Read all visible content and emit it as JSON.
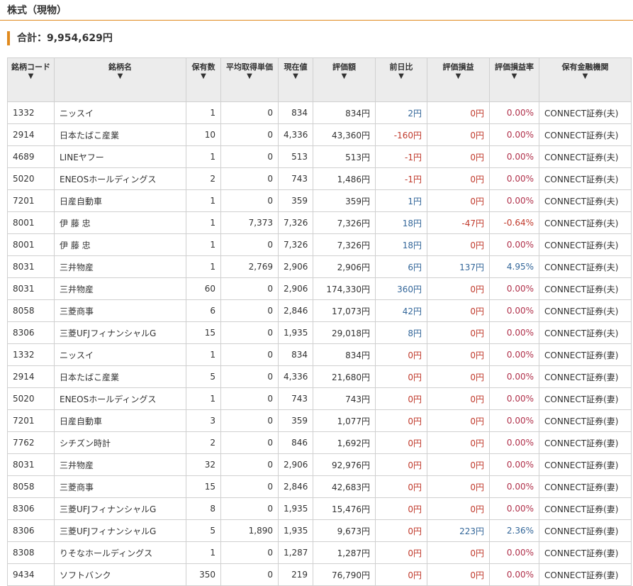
{
  "section_title": "株式（現物）",
  "total_label": "合計：9,954,629円",
  "colors": {
    "accent": "#e08a1e",
    "up": "#336699",
    "down": "#c0392b"
  },
  "headers": [
    {
      "label": "銘柄コード",
      "sort": "▼"
    },
    {
      "label": "銘柄名",
      "sort": "▼"
    },
    {
      "label": "保有数",
      "sort": "▼"
    },
    {
      "label": "平均取得単価",
      "sort": "▼"
    },
    {
      "label": "現在値",
      "sort": "▼"
    },
    {
      "label": "評価額",
      "sort": "▼"
    },
    {
      "label": "前日比",
      "sort": "▼"
    },
    {
      "label": "評価損益",
      "sort": "▼"
    },
    {
      "label": "評価損益率",
      "sort": "▼"
    },
    {
      "label": "保有金融機関",
      "sort": "▼"
    }
  ],
  "rows": [
    {
      "code": "1332",
      "name": "ニッスイ",
      "qty": "1",
      "avg": "0",
      "price": "834",
      "value": "834円",
      "change": "2円",
      "change_dir": "up",
      "pl": "0円",
      "pl_dir": "zero",
      "rate": "0.00%",
      "rate_dir": "zero",
      "inst": "CONNECT証券(夫)"
    },
    {
      "code": "2914",
      "name": "日本たばこ産業",
      "qty": "10",
      "avg": "0",
      "price": "4,336",
      "value": "43,360円",
      "change": "-160円",
      "change_dir": "down",
      "pl": "0円",
      "pl_dir": "zero",
      "rate": "0.00%",
      "rate_dir": "zero",
      "inst": "CONNECT証券(夫)"
    },
    {
      "code": "4689",
      "name": "LINEヤフー",
      "qty": "1",
      "avg": "0",
      "price": "513",
      "value": "513円",
      "change": "-1円",
      "change_dir": "down",
      "pl": "0円",
      "pl_dir": "zero",
      "rate": "0.00%",
      "rate_dir": "zero",
      "inst": "CONNECT証券(夫)"
    },
    {
      "code": "5020",
      "name": "ENEOSホールディングス",
      "qty": "2",
      "avg": "0",
      "price": "743",
      "value": "1,486円",
      "change": "-1円",
      "change_dir": "down",
      "pl": "0円",
      "pl_dir": "zero",
      "rate": "0.00%",
      "rate_dir": "zero",
      "inst": "CONNECT証券(夫)"
    },
    {
      "code": "7201",
      "name": "日産自動車",
      "qty": "1",
      "avg": "0",
      "price": "359",
      "value": "359円",
      "change": "1円",
      "change_dir": "up",
      "pl": "0円",
      "pl_dir": "zero",
      "rate": "0.00%",
      "rate_dir": "zero",
      "inst": "CONNECT証券(夫)"
    },
    {
      "code": "8001",
      "name": "伊 藤 忠",
      "qty": "1",
      "avg": "7,373",
      "price": "7,326",
      "value": "7,326円",
      "change": "18円",
      "change_dir": "up",
      "pl": "-47円",
      "pl_dir": "down",
      "rate": "-0.64%",
      "rate_dir": "down",
      "inst": "CONNECT証券(夫)"
    },
    {
      "code": "8001",
      "name": "伊 藤 忠",
      "qty": "1",
      "avg": "0",
      "price": "7,326",
      "value": "7,326円",
      "change": "18円",
      "change_dir": "up",
      "pl": "0円",
      "pl_dir": "zero",
      "rate": "0.00%",
      "rate_dir": "zero",
      "inst": "CONNECT証券(夫)"
    },
    {
      "code": "8031",
      "name": "三井物産",
      "qty": "1",
      "avg": "2,769",
      "price": "2,906",
      "value": "2,906円",
      "change": "6円",
      "change_dir": "up",
      "pl": "137円",
      "pl_dir": "up",
      "rate": "4.95%",
      "rate_dir": "up",
      "inst": "CONNECT証券(夫)"
    },
    {
      "code": "8031",
      "name": "三井物産",
      "qty": "60",
      "avg": "0",
      "price": "2,906",
      "value": "174,330円",
      "change": "360円",
      "change_dir": "up",
      "pl": "0円",
      "pl_dir": "zero",
      "rate": "0.00%",
      "rate_dir": "zero",
      "inst": "CONNECT証券(夫)"
    },
    {
      "code": "8058",
      "name": "三菱商事",
      "qty": "6",
      "avg": "0",
      "price": "2,846",
      "value": "17,073円",
      "change": "42円",
      "change_dir": "up",
      "pl": "0円",
      "pl_dir": "zero",
      "rate": "0.00%",
      "rate_dir": "zero",
      "inst": "CONNECT証券(夫)"
    },
    {
      "code": "8306",
      "name": "三菱UFJフィナンシャルG",
      "qty": "15",
      "avg": "0",
      "price": "1,935",
      "value": "29,018円",
      "change": "8円",
      "change_dir": "up",
      "pl": "0円",
      "pl_dir": "zero",
      "rate": "0.00%",
      "rate_dir": "zero",
      "inst": "CONNECT証券(夫)"
    },
    {
      "code": "1332",
      "name": "ニッスイ",
      "qty": "1",
      "avg": "0",
      "price": "834",
      "value": "834円",
      "change": "0円",
      "change_dir": "zero",
      "pl": "0円",
      "pl_dir": "zero",
      "rate": "0.00%",
      "rate_dir": "zero",
      "inst": "CONNECT証券(妻)"
    },
    {
      "code": "2914",
      "name": "日本たばこ産業",
      "qty": "5",
      "avg": "0",
      "price": "4,336",
      "value": "21,680円",
      "change": "0円",
      "change_dir": "zero",
      "pl": "0円",
      "pl_dir": "zero",
      "rate": "0.00%",
      "rate_dir": "zero",
      "inst": "CONNECT証券(妻)"
    },
    {
      "code": "5020",
      "name": "ENEOSホールディングス",
      "qty": "1",
      "avg": "0",
      "price": "743",
      "value": "743円",
      "change": "0円",
      "change_dir": "zero",
      "pl": "0円",
      "pl_dir": "zero",
      "rate": "0.00%",
      "rate_dir": "zero",
      "inst": "CONNECT証券(妻)"
    },
    {
      "code": "7201",
      "name": "日産自動車",
      "qty": "3",
      "avg": "0",
      "price": "359",
      "value": "1,077円",
      "change": "0円",
      "change_dir": "zero",
      "pl": "0円",
      "pl_dir": "zero",
      "rate": "0.00%",
      "rate_dir": "zero",
      "inst": "CONNECT証券(妻)"
    },
    {
      "code": "7762",
      "name": "シチズン時計",
      "qty": "2",
      "avg": "0",
      "price": "846",
      "value": "1,692円",
      "change": "0円",
      "change_dir": "zero",
      "pl": "0円",
      "pl_dir": "zero",
      "rate": "0.00%",
      "rate_dir": "zero",
      "inst": "CONNECT証券(妻)"
    },
    {
      "code": "8031",
      "name": "三井物産",
      "qty": "32",
      "avg": "0",
      "price": "2,906",
      "value": "92,976円",
      "change": "0円",
      "change_dir": "zero",
      "pl": "0円",
      "pl_dir": "zero",
      "rate": "0.00%",
      "rate_dir": "zero",
      "inst": "CONNECT証券(妻)"
    },
    {
      "code": "8058",
      "name": "三菱商事",
      "qty": "15",
      "avg": "0",
      "price": "2,846",
      "value": "42,683円",
      "change": "0円",
      "change_dir": "zero",
      "pl": "0円",
      "pl_dir": "zero",
      "rate": "0.00%",
      "rate_dir": "zero",
      "inst": "CONNECT証券(妻)"
    },
    {
      "code": "8306",
      "name": "三菱UFJフィナンシャルG",
      "qty": "8",
      "avg": "0",
      "price": "1,935",
      "value": "15,476円",
      "change": "0円",
      "change_dir": "zero",
      "pl": "0円",
      "pl_dir": "zero",
      "rate": "0.00%",
      "rate_dir": "zero",
      "inst": "CONNECT証券(妻)"
    },
    {
      "code": "8306",
      "name": "三菱UFJフィナンシャルG",
      "qty": "5",
      "avg": "1,890",
      "price": "1,935",
      "value": "9,673円",
      "change": "0円",
      "change_dir": "zero",
      "pl": "223円",
      "pl_dir": "up",
      "rate": "2.36%",
      "rate_dir": "up",
      "inst": "CONNECT証券(妻)"
    },
    {
      "code": "8308",
      "name": "りそなホールディングス",
      "qty": "1",
      "avg": "0",
      "price": "1,287",
      "value": "1,287円",
      "change": "0円",
      "change_dir": "zero",
      "pl": "0円",
      "pl_dir": "zero",
      "rate": "0.00%",
      "rate_dir": "zero",
      "inst": "CONNECT証券(妻)"
    },
    {
      "code": "9434",
      "name": "ソフトバンク",
      "qty": "350",
      "avg": "0",
      "price": "219",
      "value": "76,790円",
      "change": "0円",
      "change_dir": "zero",
      "pl": "0円",
      "pl_dir": "zero",
      "rate": "0.00%",
      "rate_dir": "zero",
      "inst": "CONNECT証券(妻)"
    }
  ]
}
